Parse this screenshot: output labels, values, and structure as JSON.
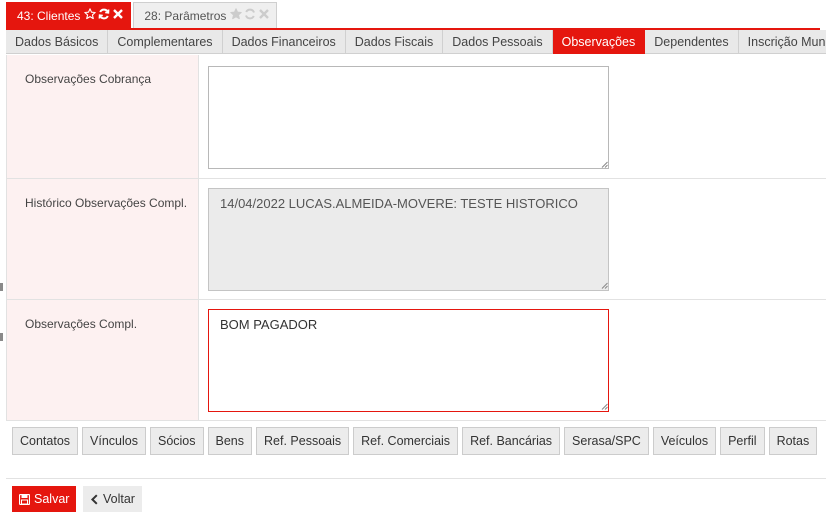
{
  "window_tabs": [
    {
      "label": "43: Clientes",
      "active": true
    },
    {
      "label": "28: Parâmetros",
      "active": false
    }
  ],
  "sub_tabs": [
    {
      "label": "Dados Básicos",
      "active": false
    },
    {
      "label": "Complementares",
      "active": false
    },
    {
      "label": "Dados Financeiros",
      "active": false
    },
    {
      "label": "Dados Fiscais",
      "active": false
    },
    {
      "label": "Dados Pessoais",
      "active": false
    },
    {
      "label": "Observações",
      "active": true
    },
    {
      "label": "Dependentes",
      "active": false
    },
    {
      "label": "Inscrição Municipal",
      "active": false
    }
  ],
  "form": {
    "obs_cobranca": {
      "label": "Observações Cobrança",
      "value": ""
    },
    "historico": {
      "label": "Histórico Observações Compl.",
      "value": "14/04/2022 LUCAS.ALMEIDA-MOVERE: TESTE HISTORICO"
    },
    "obs_compl": {
      "label": "Observações Compl.",
      "value": "BOM PAGADOR"
    }
  },
  "bottom_tabs": [
    "Contatos",
    "Vínculos",
    "Sócios",
    "Bens",
    "Ref. Pessoais",
    "Ref. Comerciais",
    "Ref. Bancárias",
    "Serasa/SPC",
    "Veículos",
    "Perfil",
    "Rotas"
  ],
  "actions": {
    "save_label": "Salvar",
    "back_label": "Voltar"
  },
  "icons": {
    "favorite": "star-icon",
    "refresh": "refresh-icon",
    "close": "close-icon",
    "save": "floppy-disk-icon",
    "back": "chevron-left-icon"
  },
  "colors": {
    "accent": "#e5160e",
    "label_bg": "#fdf1f1",
    "tab_bg": "#e9e9e9",
    "readonly_bg": "#ebebeb"
  }
}
